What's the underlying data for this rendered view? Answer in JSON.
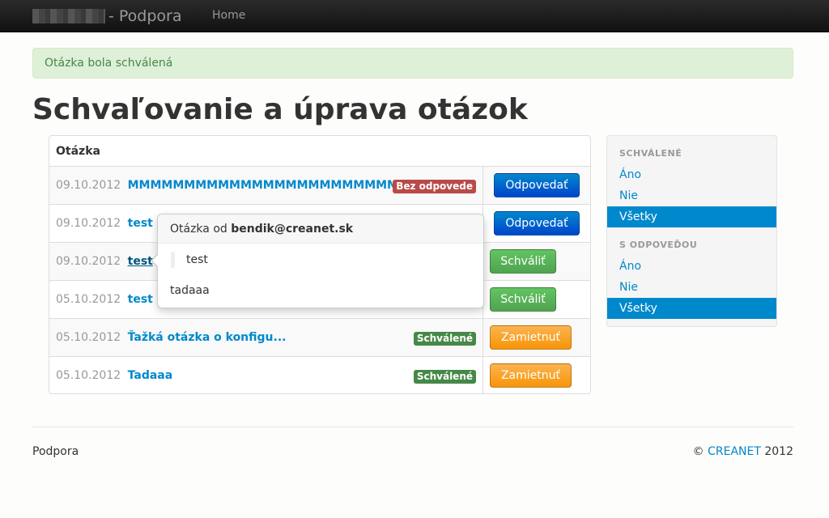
{
  "navbar": {
    "brand_suffix": "- Podpora",
    "home": "Home"
  },
  "alert": "Otázka bola schválená",
  "page_title": "Schvaľovanie a úprava otázok",
  "table": {
    "header": "Otázka",
    "rows": [
      {
        "date": "09.10.2012",
        "question": "MMMMMMMMMMMMMMMMMMMMMMMM...",
        "badge": "Bez odpovede",
        "action": "Odpovedať"
      },
      {
        "date": "09.10.2012",
        "question": "test",
        "badge": "",
        "action": "Odpovedať"
      },
      {
        "date": "09.10.2012",
        "question": "test",
        "badge": "",
        "action": "Schváliť"
      },
      {
        "date": "05.10.2012",
        "question": "test",
        "badge": "",
        "action": "Schváliť"
      },
      {
        "date": "05.10.2012",
        "question": "Ťažká otázka o konfigu...",
        "badge": "Schválené",
        "action": "Zamietnuť"
      },
      {
        "date": "05.10.2012",
        "question": "Tadaaa",
        "badge": "Schválené",
        "action": "Zamietnuť"
      }
    ]
  },
  "popover": {
    "title_prefix": "Otázka od",
    "email": "bendik@creanet.sk",
    "question": "test",
    "answer": "tadaaa"
  },
  "sidebar": {
    "approved_header": "SCHVÁLENÉ",
    "approved_items": [
      "Áno",
      "Nie",
      "Všetky"
    ],
    "answered_header": "S ODPOVEĎOU",
    "answered_items": [
      "Áno",
      "Nie",
      "Všetky"
    ]
  },
  "footer": {
    "left": "Podpora",
    "copyright": "©",
    "company": "CREANET",
    "year": "2012"
  },
  "colors": {
    "link": "#0088cc",
    "danger": "#b94a48",
    "success": "#468847",
    "primary": "#0044cc",
    "warning": "#f89406"
  }
}
